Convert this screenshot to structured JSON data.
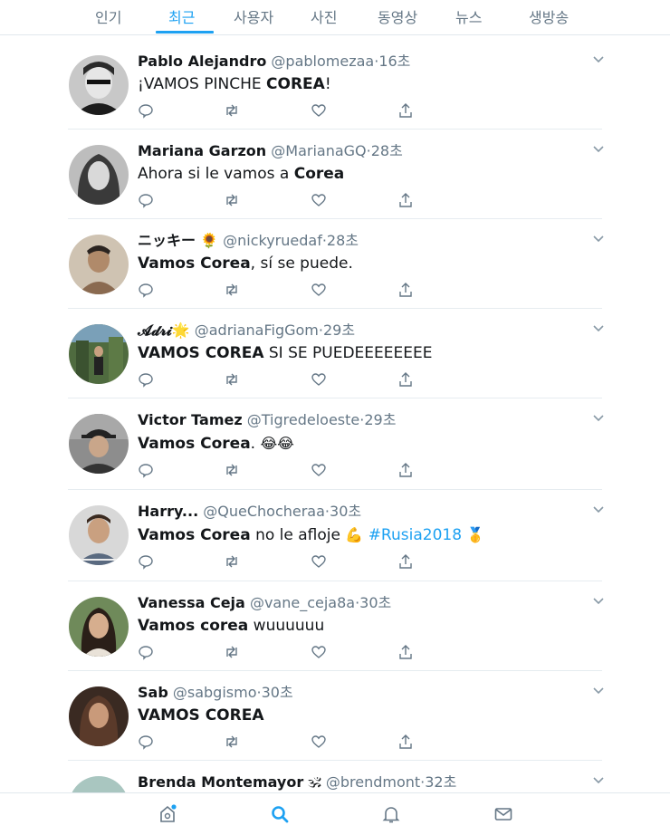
{
  "tabs": [
    {
      "label": "인기",
      "active": false
    },
    {
      "label": "최근",
      "active": true
    },
    {
      "label": "사용자",
      "active": false
    },
    {
      "label": "사진",
      "active": false
    },
    {
      "label": "동영상",
      "active": false
    },
    {
      "label": "뉴스",
      "active": false
    },
    {
      "label": "생방송",
      "active": false
    }
  ],
  "tweets": [
    {
      "name": "Pablo Alejandro",
      "handle": "@pablomezaa",
      "time": "16초",
      "text_before": "¡VAMOS PINCHE ",
      "text_bold": "COREA",
      "text_after": "!"
    },
    {
      "name": "Mariana Garzon",
      "handle": "@MarianaGQ",
      "time": "28초",
      "text_before": "Ahora si le vamos a ",
      "text_bold": "Corea",
      "text_after": ""
    },
    {
      "name": "ニッキー",
      "name_emoji": "🌻",
      "handle": "@nickyruedaf",
      "time": "28초",
      "text_bold": "Vamos Corea",
      "text_after": ", sí se puede."
    },
    {
      "name": "𝓐𝓭𝓻𝓲",
      "name_emoji": "🌟",
      "handle": "@adrianaFigGom",
      "time": "29초",
      "text_bold": "VAMOS COREA",
      "text_after": " SI SE PUEDEEEEEEEE"
    },
    {
      "name": "Victor Tamez",
      "handle": "@Tigredeloeste",
      "time": "29초",
      "text_bold": "Vamos Corea",
      "text_after": ".",
      "text_emoji": "😂😂"
    },
    {
      "name": "Harry...",
      "handle": "@QueChocheraa",
      "time": "30초",
      "text_bold": "Vamos Corea",
      "text_after": " no le afloje ",
      "text_emoji": "💪",
      "hashtag": "#Rusia2018",
      "trailing_emoji": "🥇"
    },
    {
      "name": "Vanessa Ceja",
      "handle": "@vane_ceja8a",
      "time": "30초",
      "text_bold": "Vamos corea",
      "text_after": " wuuuuuu"
    },
    {
      "name": "Sab",
      "handle": "@sabgismo",
      "time": "30초",
      "text_bold": "VAMOS COREA",
      "text_after": ""
    },
    {
      "name": "Brenda Montemayor",
      "name_emoji": "🕉",
      "handle": "@brendmont",
      "time": "32초",
      "text_bold": "",
      "text_after": ""
    }
  ],
  "separator": "·",
  "colors": {
    "accent": "#1da1f2",
    "muted": "#657786",
    "text": "#14171a",
    "border": "#e6ecf0"
  },
  "bottom_nav": [
    "home-icon",
    "search-icon",
    "notifications-bell-icon",
    "messages-envelope-icon"
  ]
}
